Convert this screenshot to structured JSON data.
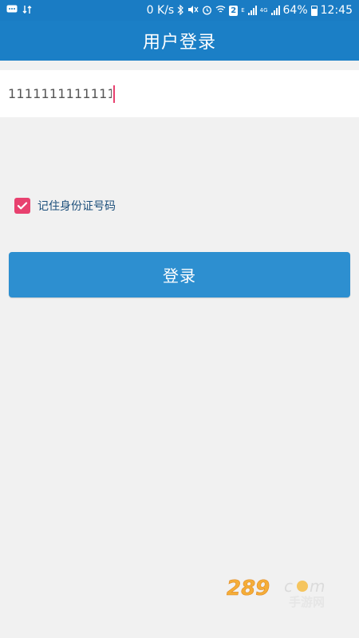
{
  "status_bar": {
    "net_speed": "0 K/s",
    "network_type": "4G",
    "lte_badge": "E",
    "battery": "64%",
    "battery_level": 0.64,
    "time": "12:45",
    "sim_slot": "2"
  },
  "header": {
    "title": "用户登录"
  },
  "form": {
    "id_number_value": "11111111111111",
    "remember_label": "记住身份证号码",
    "remember_checked": true,
    "login_label": "登录"
  },
  "watermark": {
    "text_main": "289",
    "text_com": "c m",
    "text_cn": "手游网"
  },
  "colors": {
    "primary": "#1b7fc6",
    "button": "#2d8fd0",
    "accent": "#e8416f",
    "background": "#f1f1f1"
  }
}
